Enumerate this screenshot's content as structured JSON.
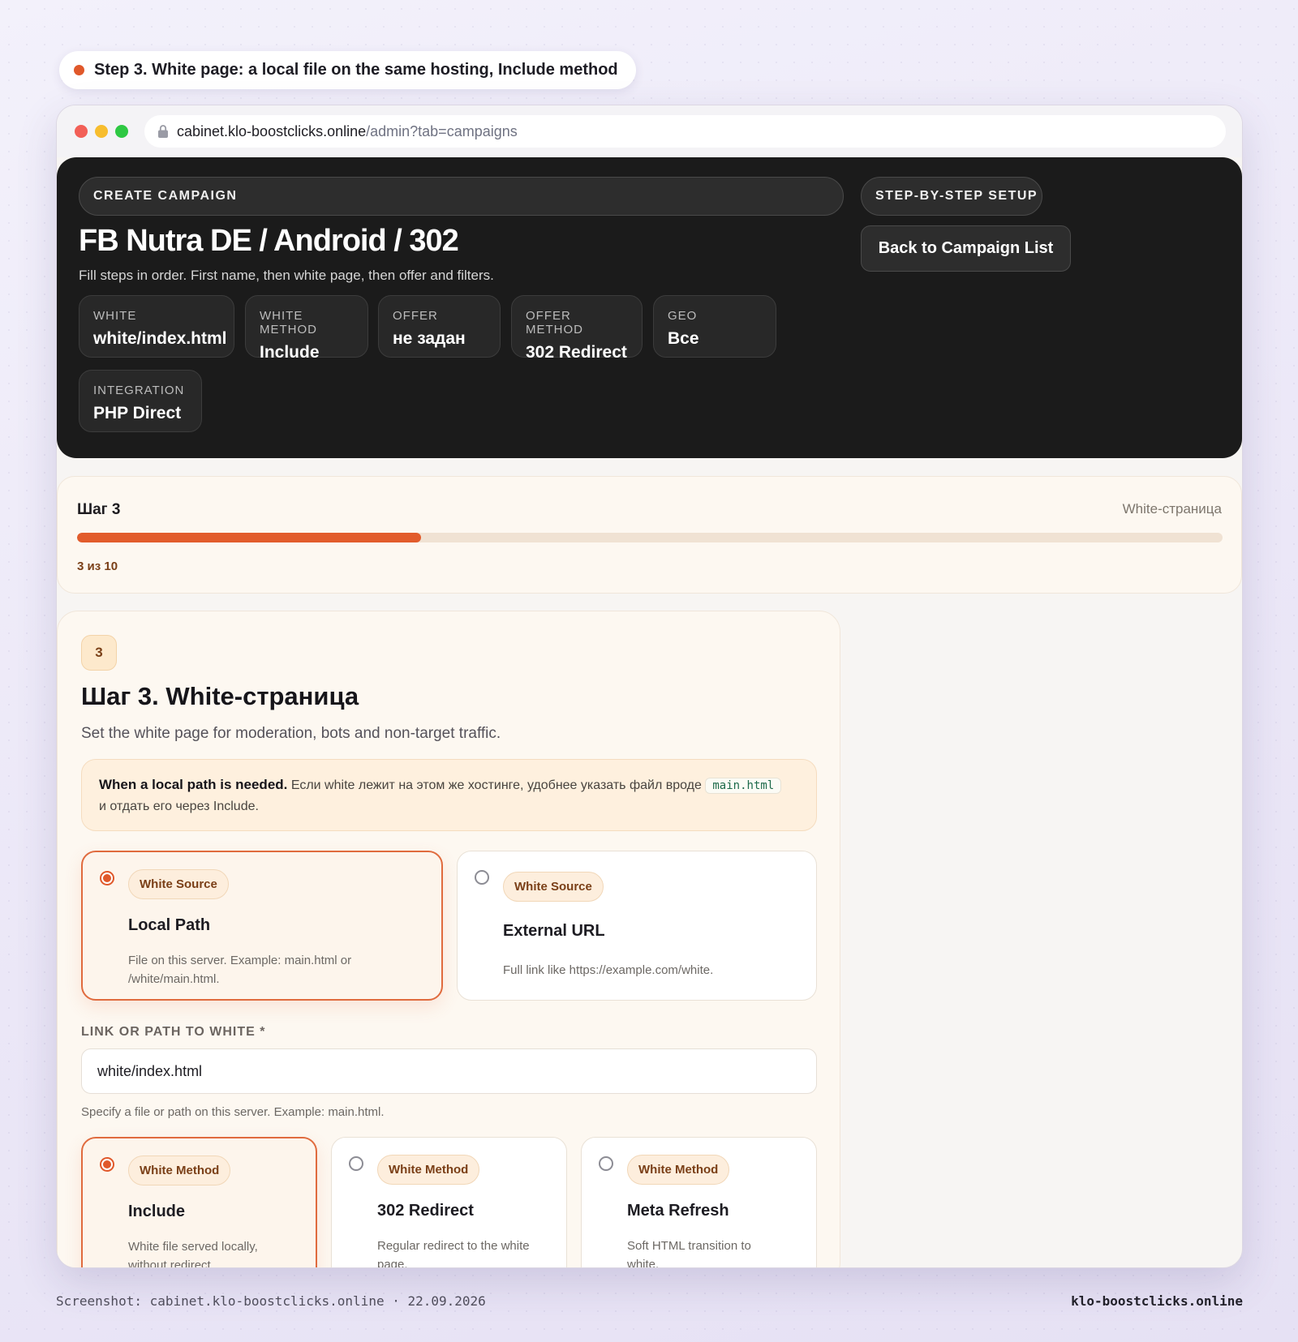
{
  "caption": "Step 3. White page: a local file on the same hosting, Include method",
  "browser": {
    "url_host": "cabinet.klo-boostclicks.online",
    "url_path": "/admin?tab=campaigns"
  },
  "hero": {
    "eyebrow": "CREATE CAMPAIGN",
    "setup_label": "STEP-BY-STEP SETUP",
    "title": "FB Nutra DE / Android / 302",
    "subtitle": "Fill steps in order. First name, then white page, then offer and filters.",
    "back_button": "Back to Campaign List",
    "stats": [
      {
        "label": "WHITE",
        "value": "white/index.html"
      },
      {
        "label": "WHITE METHOD",
        "value": "Include"
      },
      {
        "label": "OFFER",
        "value": "не задан"
      },
      {
        "label": "OFFER METHOD",
        "value": "302 Redirect"
      },
      {
        "label": "GEO",
        "value": "Все"
      },
      {
        "label": "INTEGRATION",
        "value": "PHP Direct"
      }
    ]
  },
  "progress": {
    "title": "Шаг 3",
    "section": "White-страница",
    "count": "3 из 10",
    "current": 3,
    "total": 10
  },
  "step": {
    "number": "3",
    "title": "Шаг 3. White-страница",
    "subtitle": "Set the white page for moderation, bots and non-target traffic.",
    "note": {
      "bold": "When a local path is needed.",
      "text_before": "Если white лежит на этом же хостинге, удобнее указать файл вроде",
      "code": "main.html",
      "text_after": "и отдать его через Include."
    },
    "source_options": [
      {
        "chip": "White Source",
        "title": "Local Path",
        "desc": "File on this server. Example: main.html or /white/main.html.",
        "selected": true
      },
      {
        "chip": "White Source",
        "title": "External URL",
        "desc": "Full link like https://example.com/white.",
        "selected": false
      }
    ],
    "field": {
      "label": "LINK OR PATH TO WHITE *",
      "value": "white/index.html",
      "hint": "Specify a file or path on this server. Example: main.html."
    },
    "method_options": [
      {
        "chip": "White Method",
        "title": "Include",
        "desc": "White file served locally, without redirect.",
        "selected": true
      },
      {
        "chip": "White Method",
        "title": "302 Redirect",
        "desc": "Regular redirect to the white page.",
        "selected": false
      },
      {
        "chip": "White Method",
        "title": "Meta Refresh",
        "desc": "Soft HTML transition to white.",
        "selected": false
      }
    ]
  },
  "footer": {
    "left": "Screenshot: cabinet.klo-boostclicks.online · 22.09.2026",
    "right": "klo-boostclicks.online"
  },
  "colors": {
    "accent": "#e25c2c",
    "hero_bg": "#1b1b1b",
    "card_bg": "#fdf8f1"
  }
}
